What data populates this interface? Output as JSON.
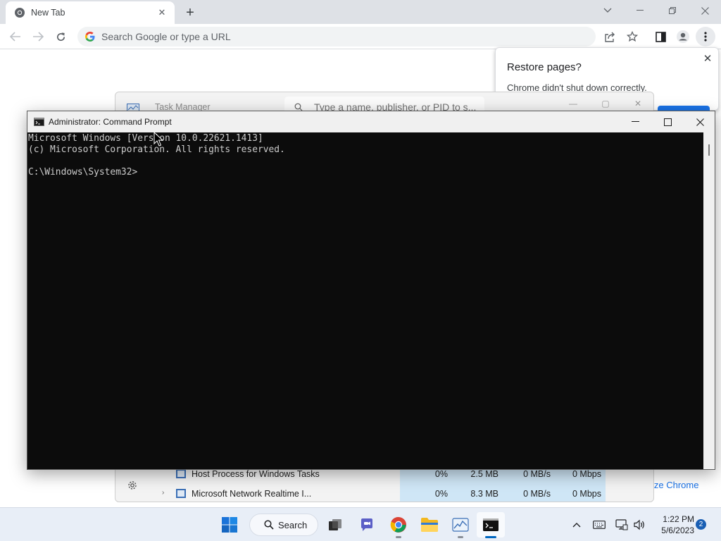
{
  "chrome": {
    "tab_title": "New Tab",
    "omnibox_placeholder": "Search Google or type a URL",
    "restore": {
      "title": "Restore pages?",
      "message": "Chrome didn't shut down correctly."
    },
    "customize_text": "ize Chrome"
  },
  "task_manager": {
    "title": "Task Manager",
    "search_placeholder": "Type a name, publisher, or PID to s...",
    "rows": [
      {
        "name": "Host Process for Windows Tasks",
        "cpu": "0%",
        "memory": "2.5 MB",
        "disk": "0 MB/s",
        "network": "0 Mbps",
        "expandable": false
      },
      {
        "name": "Microsoft Network Realtime I...",
        "cpu": "0%",
        "memory": "8.3 MB",
        "disk": "0 MB/s",
        "network": "0 Mbps",
        "expandable": true
      }
    ]
  },
  "cmd": {
    "title": "Administrator: Command Prompt",
    "lines": [
      "Microsoft Windows [Version 10.0.22621.1413]",
      "(c) Microsoft Corporation. All rights reserved.",
      "",
      "C:\\Windows\\System32>"
    ]
  },
  "taskbar": {
    "search_label": "Search",
    "time": "1:22 PM",
    "date": "5/6/2023",
    "notification_count": "2"
  },
  "colors": {
    "accent": "#1a73e8",
    "console_bg": "#0c0c0c",
    "console_fg": "#cccccc",
    "taskbar_bg": "#e8eef7"
  }
}
